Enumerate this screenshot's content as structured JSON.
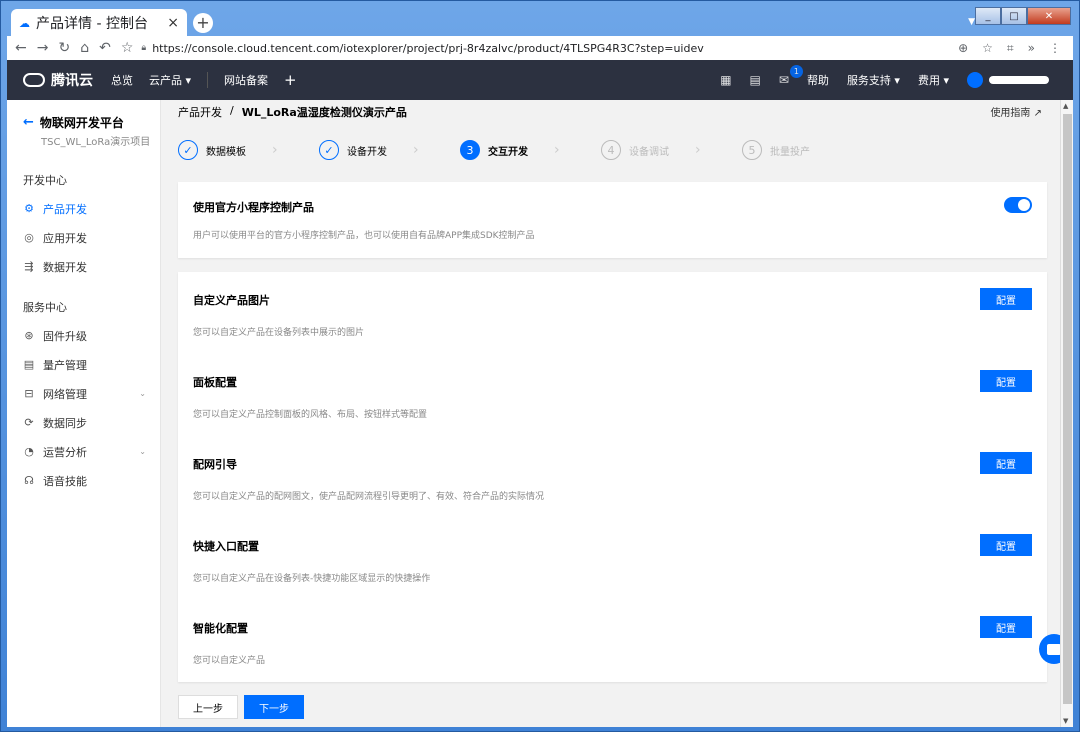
{
  "browser": {
    "tab_title": "产品详情 - 控制台",
    "url": "https://console.cloud.tencent.com/iotexplorer/project/prj-8r4zalvc/product/4TLSPG4R3C?step=uidev"
  },
  "header": {
    "brand": "腾讯云",
    "nav": [
      "总览",
      "云产品 ▾",
      "网站备案"
    ],
    "add": "+",
    "mail_badge": "1",
    "help": "帮助",
    "support": "服务支持 ▾",
    "billing": "费用 ▾"
  },
  "sidebar": {
    "platform": "物联网开发平台",
    "project": "TSC_WL_LoRa演示项目",
    "group1": "开发中心",
    "items1": [
      {
        "label": "产品开发",
        "icon": "gear-icon"
      },
      {
        "label": "应用开发",
        "icon": "app-icon"
      },
      {
        "label": "数据开发",
        "icon": "data-icon"
      }
    ],
    "group2": "服务中心",
    "items2": [
      {
        "label": "固件升级",
        "icon": "firmware-icon"
      },
      {
        "label": "量产管理",
        "icon": "batch-icon"
      },
      {
        "label": "网络管理",
        "icon": "network-icon"
      },
      {
        "label": "数据同步",
        "icon": "sync-icon"
      },
      {
        "label": "运营分析",
        "icon": "analytics-icon"
      },
      {
        "label": "语音技能",
        "icon": "voice-icon"
      }
    ]
  },
  "breadcrumb": {
    "root": "产品开发",
    "sep": "/",
    "current": "WL_LoRa温湿度检测仪演示产品"
  },
  "guide": "使用指南 ↗",
  "steps": [
    {
      "num": "✓",
      "label": "数据模板"
    },
    {
      "num": "✓",
      "label": "设备开发"
    },
    {
      "num": "3",
      "label": "交互开发"
    },
    {
      "num": "4",
      "label": "设备调试"
    },
    {
      "num": "5",
      "label": "批量投产"
    }
  ],
  "mini_program": {
    "title": "使用官方小程序控制产品",
    "desc": "用户可以使用平台的官方小程序控制产品，也可以使用自有品牌APP集成SDK控制产品"
  },
  "sections": [
    {
      "title": "自定义产品图片",
      "desc": "您可以自定义产品在设备列表中展示的图片",
      "button": "配置"
    },
    {
      "title": "面板配置",
      "desc": "您可以自定义产品控制面板的风格、布局、按钮样式等配置",
      "button": "配置"
    },
    {
      "title": "配网引导",
      "desc": "您可以自定义产品的配网图文，使产品配网流程引导更明了、有效、符合产品的实际情况",
      "button": "配置"
    },
    {
      "title": "快捷入口配置",
      "desc": "您可以自定义产品在设备列表-快捷功能区域显示的快捷操作",
      "button": "配置"
    },
    {
      "title": "智能化配置",
      "desc": "您可以自定义产品",
      "button": "配置"
    }
  ],
  "footer": {
    "prev": "上一步",
    "next": "下一步"
  }
}
